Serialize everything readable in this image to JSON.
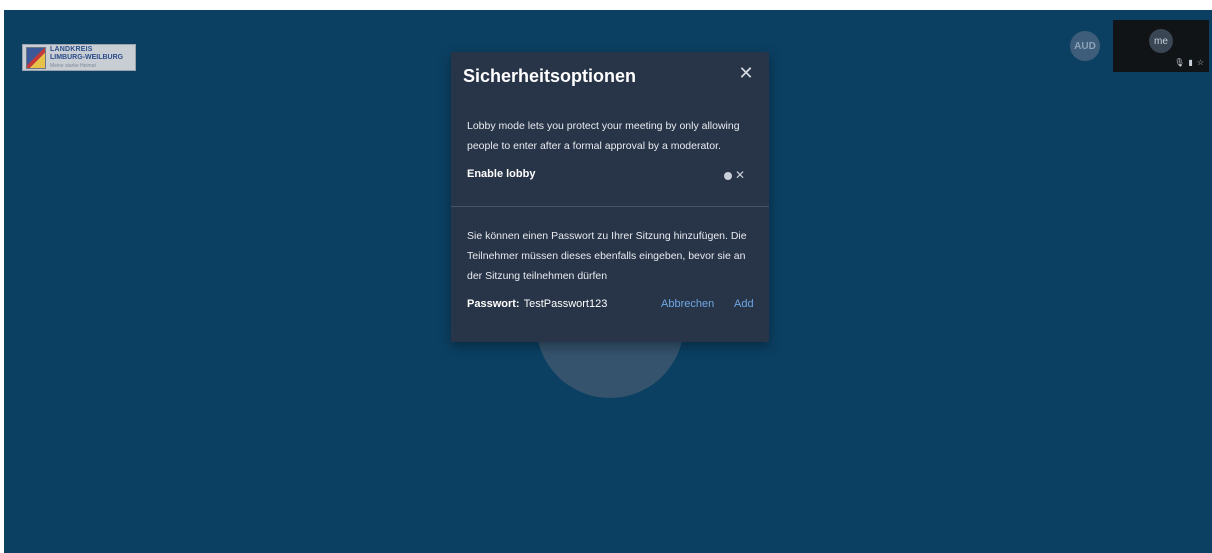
{
  "branding": {
    "logo_line1": "LANDKREIS",
    "logo_line2": "LIMBURG-WEILBURG",
    "logo_line3": "Meine starke Heimat"
  },
  "participants": {
    "avatar_initials": "AUD",
    "self_label": "me"
  },
  "dialog": {
    "title": "Sicherheitsoptionen",
    "close_icon": "close-icon",
    "lobby": {
      "description": "Lobby mode lets you protect your meeting by only allowing people to enter after a formal approval by a moderator.",
      "toggle_label": "Enable lobby",
      "enabled": false
    },
    "password": {
      "description": "Sie können einen Passwort zu Ihrer Sitzung hinzufügen. Die Teilnehmer müssen dieses ebenfalls eingeben, bevor sie an der Sitzung teilnehmen dürfen",
      "label": "Passwort:",
      "value": "TestPasswort123",
      "cancel_label": "Abbrechen",
      "add_label": "Add"
    }
  },
  "colors": {
    "background": "#0b4063",
    "dialog": "#283447",
    "link": "#6fa8e6"
  }
}
